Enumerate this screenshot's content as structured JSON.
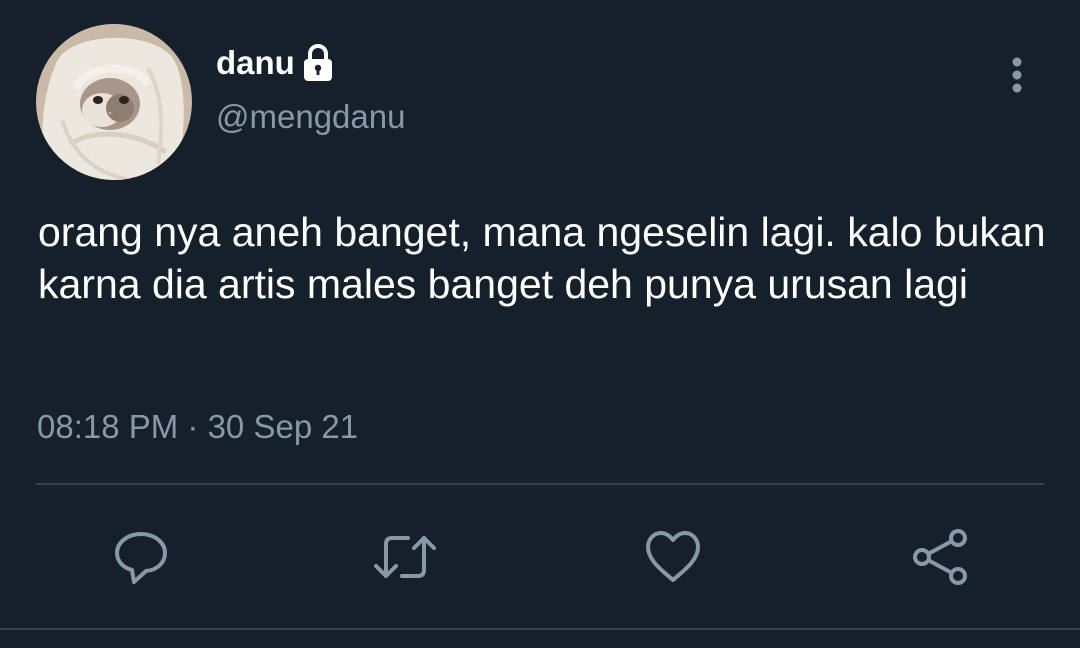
{
  "tweet": {
    "display_name": "danu",
    "handle": "@mengdanu",
    "text": "orang nya aneh banget, mana ngeselin lagi. kalo bukan karna dia artis males banget deh punya urusan lagi",
    "timestamp": "08:18 PM · 30 Sep 21",
    "protected": true
  },
  "icons": {
    "avatar": "cat-wrapped-in-blanket",
    "lock": "lock-icon",
    "more": "more-vertical-icon",
    "reply": "reply-icon",
    "retweet": "retweet-icon",
    "like": "heart-icon",
    "share": "share-icon"
  },
  "colors": {
    "background": "#15202b",
    "text_primary": "#ffffff",
    "text_secondary": "#8899a6",
    "icon": "#8899a6",
    "divider": "#38444d"
  }
}
